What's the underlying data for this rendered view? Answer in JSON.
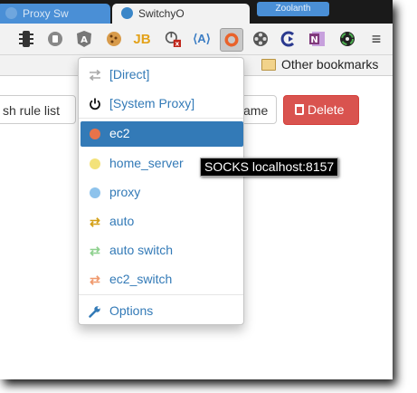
{
  "tabs": [
    {
      "label": "Proxy Sw",
      "active": false
    },
    {
      "label": "SwitchyO",
      "active": true
    }
  ],
  "window_controls": {
    "label": "Zoolanth"
  },
  "toolbar": {
    "extension_icons": [
      "traffic-light-icon",
      "hand-stop-icon",
      "angular-icon",
      "cookie-icon",
      "jb-icon",
      "power-x-icon",
      "a11y-icon",
      "switchyomega-icon",
      "film-reel-icon",
      "c-arrow-icon",
      "onenote-icon",
      "color-wheel-icon",
      "menu-icon"
    ],
    "letter_jb": "JB",
    "letter_a": "⟨A⟩",
    "letter_n": "N",
    "menu_glyph": "≡"
  },
  "bookmarks": {
    "other_label": "Other bookmarks"
  },
  "page": {
    "rule_button": "sh rule list",
    "rename_button": "ame",
    "delete_button": "Delete"
  },
  "menu": {
    "items": [
      {
        "label": "[Direct]",
        "icon": "direct-arrows-icon"
      },
      {
        "label": "[System Proxy]",
        "icon": "power-icon"
      },
      {
        "label": "ec2",
        "icon": "globe-icon",
        "color": "#e8734a",
        "selected": true
      },
      {
        "label": "home_server",
        "icon": "globe-icon",
        "color": "#f3e27a"
      },
      {
        "label": "proxy",
        "icon": "globe-icon",
        "color": "#8ec3ec"
      },
      {
        "label": "auto",
        "icon": "cycle-icon",
        "color": "#d4a017"
      },
      {
        "label": "auto switch",
        "icon": "cycle-icon",
        "color": "#8fd18f"
      },
      {
        "label": "ec2_switch",
        "icon": "cycle-icon",
        "color": "#f09a6e"
      },
      {
        "label": "Options",
        "icon": "wrench-icon"
      }
    ]
  },
  "tooltip": {
    "text": "SOCKS localhost:8157"
  },
  "colors": {
    "accent": "#337ab7",
    "danger": "#d9534f"
  }
}
